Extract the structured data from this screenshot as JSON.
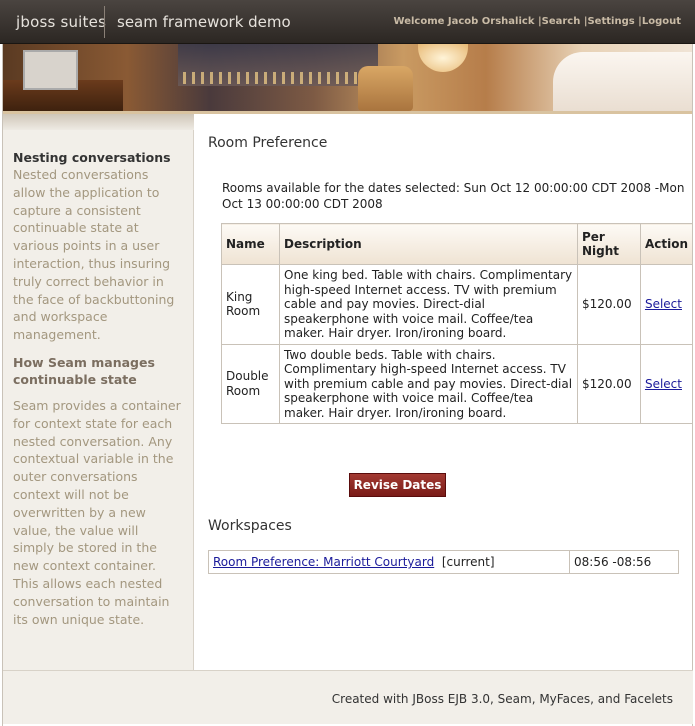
{
  "header": {
    "brand_primary": "jboss suites",
    "brand_secondary": "seam framework demo",
    "welcome": "Welcome Jacob Orshalick",
    "nav": [
      {
        "label": "Search"
      },
      {
        "label": "Settings"
      },
      {
        "label": "Logout"
      }
    ]
  },
  "sidebar": {
    "heading1": "Nesting conversations",
    "para1": "Nested conversations allow the application to capture a consistent continuable state at various points in a user interaction, thus insuring truly correct behavior in the face of backbuttoning and workspace management.",
    "heading2": "How Seam manages continuable state",
    "para2": "Seam provides a container for context state for each nested conversation. Any contextual variable in the outer conversations context will not be overwritten by a new value, the value will simply be stored in the new context container. This allows each nested conversation to maintain its own unique state."
  },
  "main": {
    "title": "Room Preference",
    "availability": "Rooms available for the dates selected: Sun Oct 12 00:00:00 CDT 2008 -Mon Oct 13 00:00:00 CDT 2008",
    "table": {
      "headers": [
        "Name",
        "Description",
        "Per Night",
        "Action"
      ],
      "rows": [
        {
          "name": "King Room",
          "description": "One king bed. Table with chairs. Complimentary high-speed Internet access. TV with premium cable and pay movies. Direct-dial speakerphone with voice mail. Coffee/tea maker. Hair dryer. Iron/ironing board.",
          "price": "$120.00",
          "action": "Select"
        },
        {
          "name": "Double Room",
          "description": "Two double beds. Table with chairs. Complimentary high-speed Internet access. TV with premium cable and pay movies. Direct-dial speakerphone with voice mail. Coffee/tea maker. Hair dryer. Iron/ironing board.",
          "price": "$120.00",
          "action": "Select"
        }
      ]
    },
    "revise_label": "Revise Dates",
    "workspaces": {
      "title": "Workspaces",
      "items": [
        {
          "link": "Room Preference: Marriott Courtyard",
          "status": "[current]",
          "time": "08:56 -08:56"
        }
      ]
    }
  },
  "footer": {
    "text": "Created with JBoss EJB 3.0, Seam, MyFaces, and Facelets"
  },
  "colors": {
    "header_bg": "#2c2723",
    "nav_text": "#c9bba6",
    "sidebar_bg": "#f2efe9",
    "sidebar_text": "#a3977f",
    "button_bg": "#8b221d",
    "link": "#1a1a9a"
  }
}
